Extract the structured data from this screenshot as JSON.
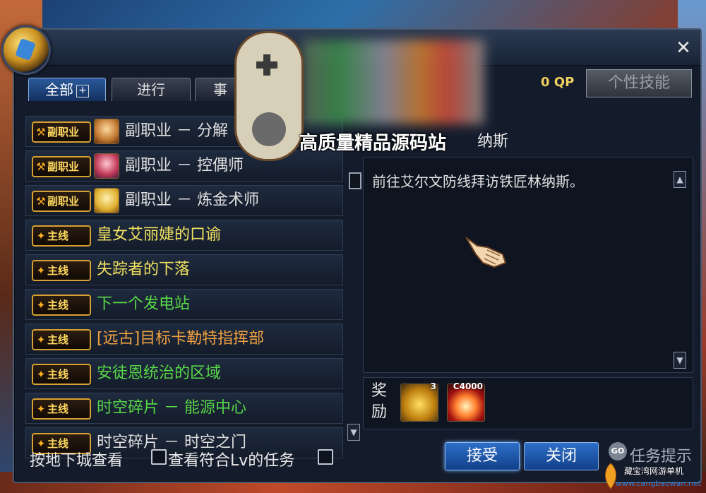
{
  "window": {
    "close_glyph": "✕"
  },
  "tabs": [
    {
      "label": "全部",
      "active": true,
      "extra": "+"
    },
    {
      "label": "进行",
      "active": false
    },
    {
      "label": "事",
      "active": false
    }
  ],
  "qp": "0 QP",
  "skill_button": "个性技能",
  "quests": [
    {
      "badge": "副职业",
      "badge_icon": "crossed-axes-icon",
      "title": "副职业 － 分解",
      "color": "#e0e0e0",
      "avatar": true
    },
    {
      "badge": "副职业",
      "badge_icon": "crossed-axes-icon",
      "title": "副职业 － 控偶师",
      "color": "#e0e0e0",
      "avatar": true
    },
    {
      "badge": "副职业",
      "badge_icon": "crossed-axes-icon",
      "title": "副职业 － 炼金术师",
      "color": "#e0e0e0",
      "avatar": true
    },
    {
      "badge": "主线",
      "badge_icon": "main-quest-icon",
      "title": "皇女艾丽婕的口谕",
      "color": "#f0e060",
      "avatar": false
    },
    {
      "badge": "主线",
      "badge_icon": "main-quest-icon",
      "title": "失踪者的下落",
      "color": "#f0e060",
      "avatar": false
    },
    {
      "badge": "主线",
      "badge_icon": "main-quest-icon",
      "title": "下一个发电站",
      "color": "#58d848",
      "avatar": false
    },
    {
      "badge": "主线",
      "badge_icon": "main-quest-icon",
      "title": "[远古]目标卡勒特指挥部",
      "color": "#f0a040",
      "avatar": false
    },
    {
      "badge": "主线",
      "badge_icon": "main-quest-icon",
      "title": "安徒恩统治的区域",
      "color": "#58d848",
      "avatar": false
    },
    {
      "badge": "主线",
      "badge_icon": "main-quest-icon",
      "title": "时空碎片 － 能源中心",
      "color": "#58d848",
      "avatar": false
    },
    {
      "badge": "主线",
      "badge_icon": "main-quest-icon",
      "title": "时空碎片 － 时空之门",
      "color": "#e0e0e0",
      "avatar": false
    }
  ],
  "detail": {
    "quest_name": "纳斯",
    "description": "前往艾尔文防线拜访铁匠林纳斯。"
  },
  "reward": {
    "label_line1": "奖",
    "label_line2": "励",
    "coins_qty": "3",
    "exp_qty": "C4000"
  },
  "footer": {
    "dungeon_view": "按地下城查看",
    "level_filter": "查看符合Lv的任务",
    "accept": "接受",
    "close": "关闭",
    "go": "GO",
    "hint": "任务提示"
  },
  "overlay": {
    "site_title": "高质量精品源码站"
  },
  "watermark": {
    "name": "藏宝湾网游单机",
    "url": "www.cangbaowan.net"
  }
}
